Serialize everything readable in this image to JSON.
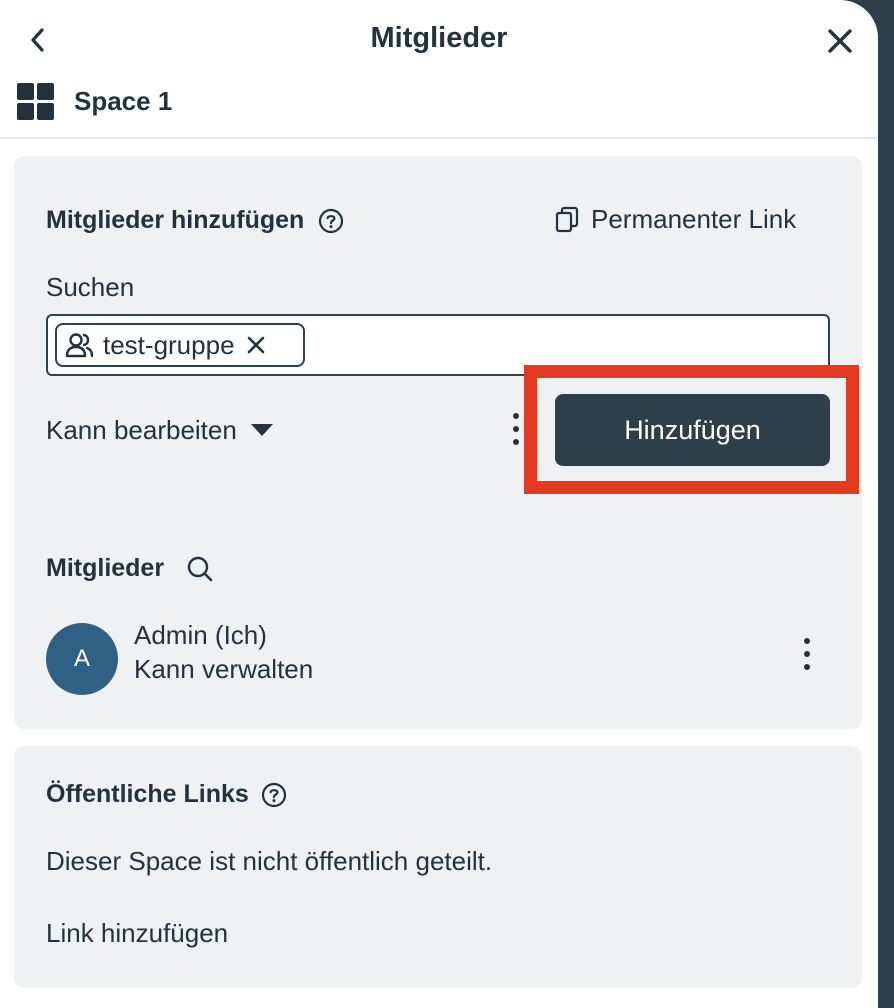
{
  "header": {
    "title": "Mitglieder",
    "back_icon": "chevron-left-icon",
    "close_icon": "close-icon"
  },
  "space": {
    "icon": "grid-icon",
    "name": "Space 1"
  },
  "add_members": {
    "title": "Mitglieder hinzufügen",
    "permanent_link_label": "Permanenter Link",
    "search_label": "Suchen",
    "chips": [
      {
        "icon": "group-icon",
        "label": "test-gruppe"
      }
    ],
    "permission_selected": "Kann bearbeiten",
    "add_button_label": "Hinzufügen"
  },
  "members": {
    "title": "Mitglieder",
    "list": [
      {
        "initial": "A",
        "name": "Admin (Ich)",
        "role": "Kann verwalten"
      }
    ]
  },
  "public_links": {
    "title": "Öffentliche Links",
    "description": "Dieser Space ist nicht öffentlich geteilt.",
    "add_link_label": "Link hinzufügen"
  },
  "colors": {
    "primary": "#2c3f4b",
    "highlight": "#e43a21",
    "avatar": "#2f6185",
    "card_bg": "#f0f1f3"
  }
}
